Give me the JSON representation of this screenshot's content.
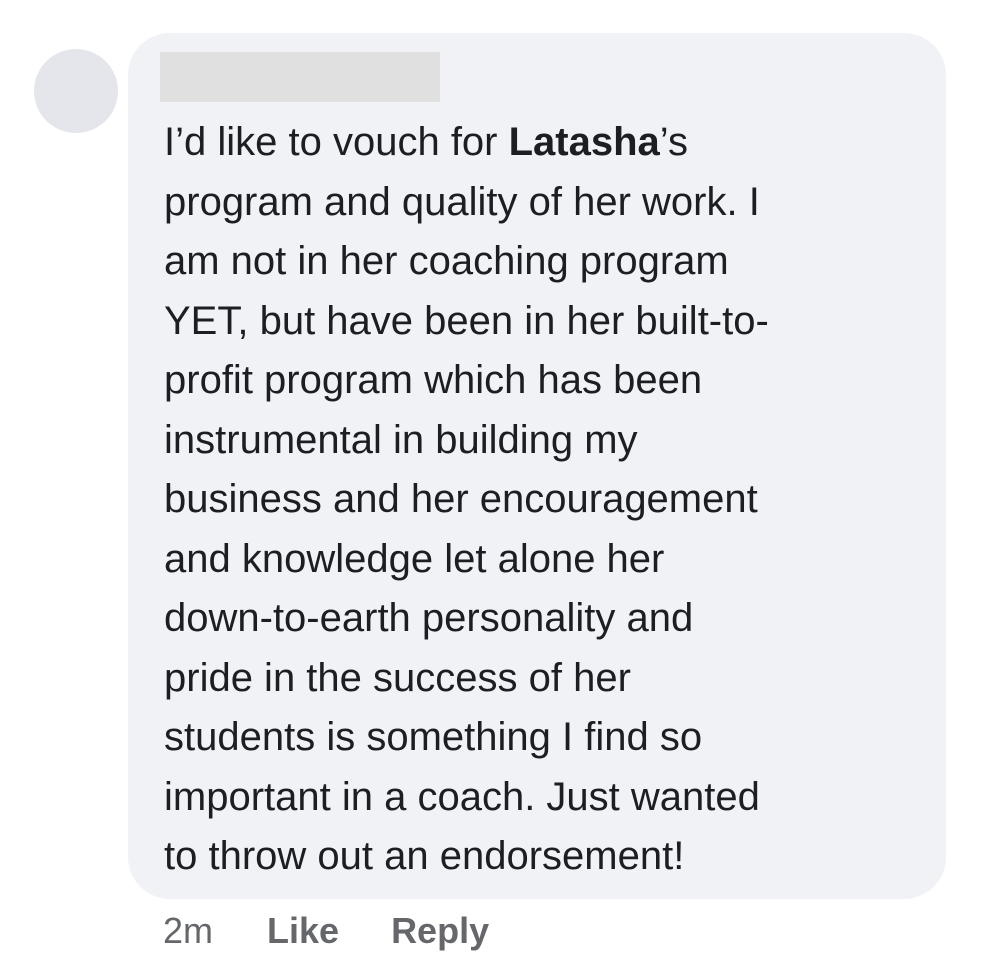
{
  "comment": {
    "author_name": "",
    "lines": [
      {
        "before": "I’d like to vouch for ",
        "mention": "Latasha",
        "after": "’s"
      },
      {
        "text": "program and quality of her work. I"
      },
      {
        "text": "am not in her coaching program"
      },
      {
        "text": "YET, but have been in her built-to-"
      },
      {
        "text": "profit program which has been"
      },
      {
        "text": "instrumental in building my"
      },
      {
        "text": "business and her encouragement"
      },
      {
        "text": "and knowledge let alone her"
      },
      {
        "text": "down-to-earth personality and"
      },
      {
        "text": "pride in the success of her"
      },
      {
        "text": "students is something I find so"
      },
      {
        "text": "important in a coach. Just wanted"
      },
      {
        "text": "to throw out an endorsement!"
      }
    ]
  },
  "actions": {
    "timestamp": "2m",
    "like_label": "Like",
    "reply_label": "Reply"
  },
  "colors": {
    "bubble_background": "#f0f2f5",
    "avatar_placeholder": "#e4e6eb",
    "redaction": "#e0e0e0",
    "text": "#1c1e21",
    "secondary_text": "#65676b"
  }
}
